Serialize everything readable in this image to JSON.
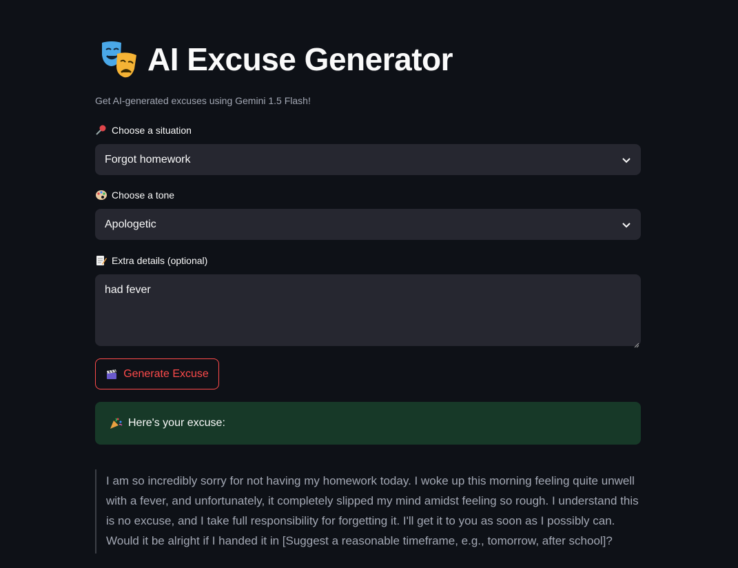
{
  "header": {
    "title": "AI Excuse Generator",
    "title_icon": "theater-masks-icon",
    "caption": "Get AI-generated excuses using Gemini 1.5 Flash!"
  },
  "situation": {
    "label": "Choose a situation",
    "label_icon": "pushpin-icon",
    "selected": "Forgot homework"
  },
  "tone": {
    "label": "Choose a tone",
    "label_icon": "artist-palette-icon",
    "selected": "Apologetic"
  },
  "details": {
    "label": "Extra details (optional)",
    "label_icon": "memo-icon",
    "value": "had fever"
  },
  "generate_button": {
    "label": "Generate Excuse",
    "icon": "clapper-board-icon"
  },
  "result": {
    "success_text": "Here's your excuse:",
    "success_icon": "party-popper-icon",
    "excuse": "I am so incredibly sorry for not having my homework today. I woke up this morning feeling quite unwell with a fever, and unfortunately, it completely slipped my mind amidst feeling so rough. I understand this is no excuse, and I take full responsibility for forgetting it. I'll get it to you as soon as I possibly can. Would it be alright if I handed it in [Suggest a reasonable timeframe, e.g., tomorrow, after school]?"
  },
  "colors": {
    "background": "#0e1117",
    "input_bg": "#262730",
    "accent": "#ff4b4b",
    "success_bg": "#173928"
  }
}
